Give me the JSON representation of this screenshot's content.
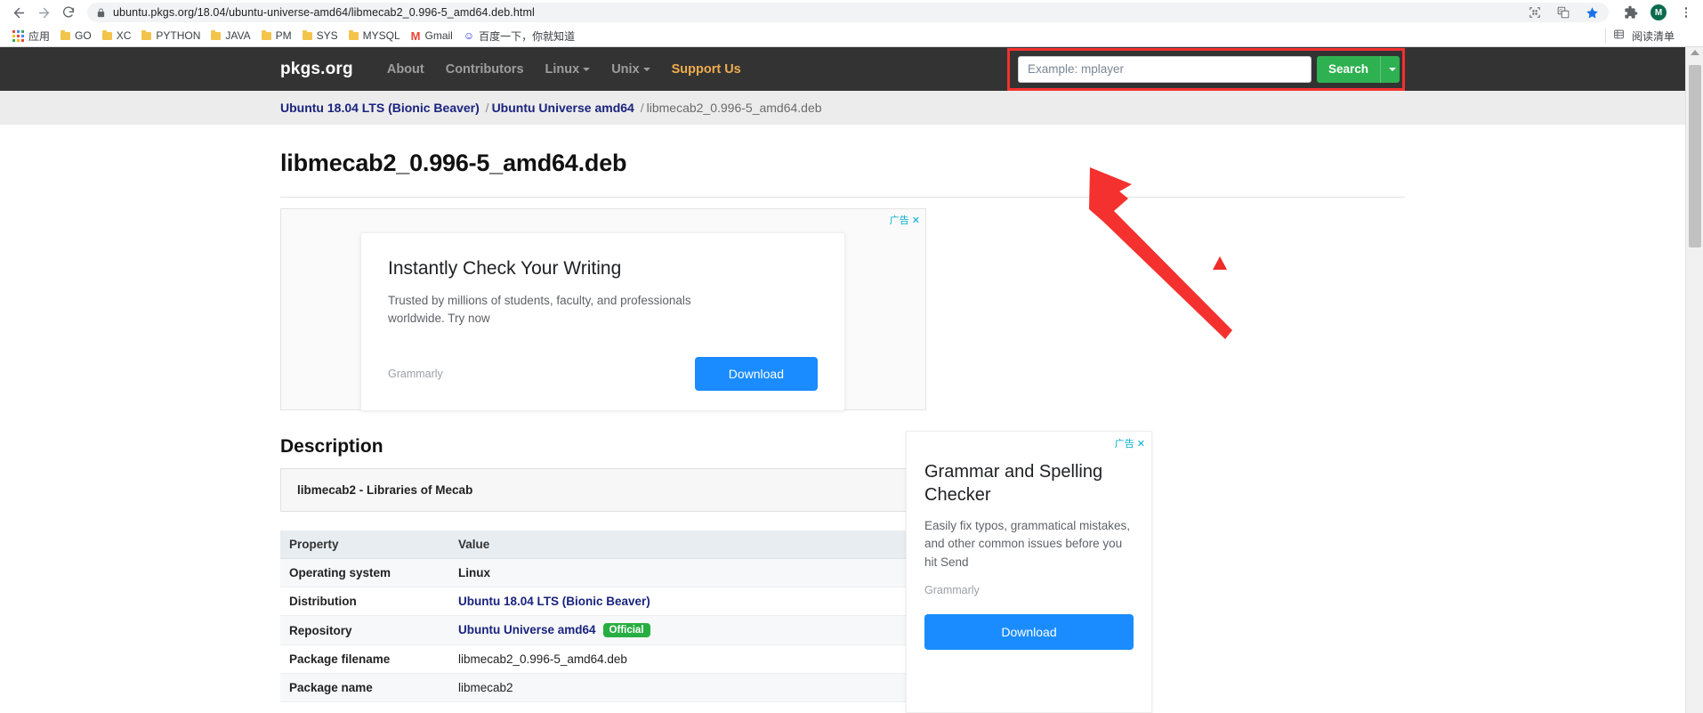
{
  "browser": {
    "back_icon": "back-arrow-icon",
    "forward_icon": "forward-arrow-icon",
    "reload_icon": "reload-icon",
    "lock_icon": "lock-icon",
    "url": "ubuntu.pkgs.org/18.04/ubuntu-universe-amd64/libmecab2_0.996-5_amd64.deb.html",
    "omnibox_icons": [
      "qr-code-icon",
      "translate-icon",
      "bookmark-star-icon"
    ],
    "toolbar_icons": [
      "extensions-puzzle-icon",
      "profile-avatar",
      "more-menu-icon"
    ],
    "avatar_letter": "M",
    "bookmarks": [
      {
        "label": "应用",
        "icon": "apps-grid-icon"
      },
      {
        "label": "GO",
        "icon": "folder-icon"
      },
      {
        "label": "XC",
        "icon": "folder-icon"
      },
      {
        "label": "PYTHON",
        "icon": "folder-icon"
      },
      {
        "label": "JAVA",
        "icon": "folder-icon"
      },
      {
        "label": "PM",
        "icon": "folder-icon"
      },
      {
        "label": "SYS",
        "icon": "folder-icon"
      },
      {
        "label": "MYSQL",
        "icon": "folder-icon"
      },
      {
        "label": "Gmail",
        "icon": "gmail-icon"
      },
      {
        "label": "百度一下，你就知道",
        "icon": "baidu-icon"
      }
    ],
    "reading_list_label": "阅读清单"
  },
  "site": {
    "brand": "pkgs.org",
    "nav": [
      {
        "label": "About",
        "caret": false
      },
      {
        "label": "Contributors",
        "caret": false
      },
      {
        "label": "Linux",
        "caret": true
      },
      {
        "label": "Unix",
        "caret": true
      },
      {
        "label": "Support Us",
        "caret": false,
        "highlight": true
      }
    ],
    "search": {
      "placeholder": "Example: mplayer",
      "value": "",
      "button_label": "Search",
      "dropdown_icon": "chevron-down-icon",
      "highlight_color": "#f4312f"
    }
  },
  "breadcrumb": {
    "items": [
      {
        "label": "Ubuntu 18.04 LTS (Bionic Beaver)",
        "link": true
      },
      {
        "label": "Ubuntu Universe amd64",
        "link": true
      },
      {
        "label": "libmecab2_0.996-5_amd64.deb",
        "link": false
      }
    ],
    "separator": "/"
  },
  "page": {
    "title": "libmecab2_0.996-5_amd64.deb",
    "description_heading": "Description",
    "description_text": "libmecab2 - Libraries of Mecab"
  },
  "ad_main": {
    "label": "广告",
    "close_icon": "close-icon",
    "heading": "Instantly Check Your Writing",
    "body": "Trusted by millions of students, faculty, and professionals worldwide. Try now",
    "brand": "Grammarly",
    "cta": "Download"
  },
  "ad_side": {
    "label": "广告",
    "close_icon": "close-icon",
    "heading": "Grammar and Spelling Checker",
    "body": "Easily fix typos, grammatical mistakes, and other common issues before you hit Send",
    "brand": "Grammarly",
    "cta": "Download"
  },
  "properties": {
    "headers": [
      "Property",
      "Value"
    ],
    "rows": [
      {
        "key": "Operating system",
        "value": "Linux",
        "style": "bold"
      },
      {
        "key": "Distribution",
        "value": "Ubuntu 18.04 LTS (Bionic Beaver)",
        "style": "link"
      },
      {
        "key": "Repository",
        "value": "Ubuntu Universe amd64",
        "style": "link",
        "badge": "Official"
      },
      {
        "key": "Package filename",
        "value": "libmecab2_0.996-5_amd64.deb",
        "style": "plain"
      },
      {
        "key": "Package name",
        "value": "libmecab2",
        "style": "plain"
      }
    ]
  },
  "annotation": {
    "arrow_color": "#f4312f",
    "cursor_color": "#ee2c28"
  }
}
